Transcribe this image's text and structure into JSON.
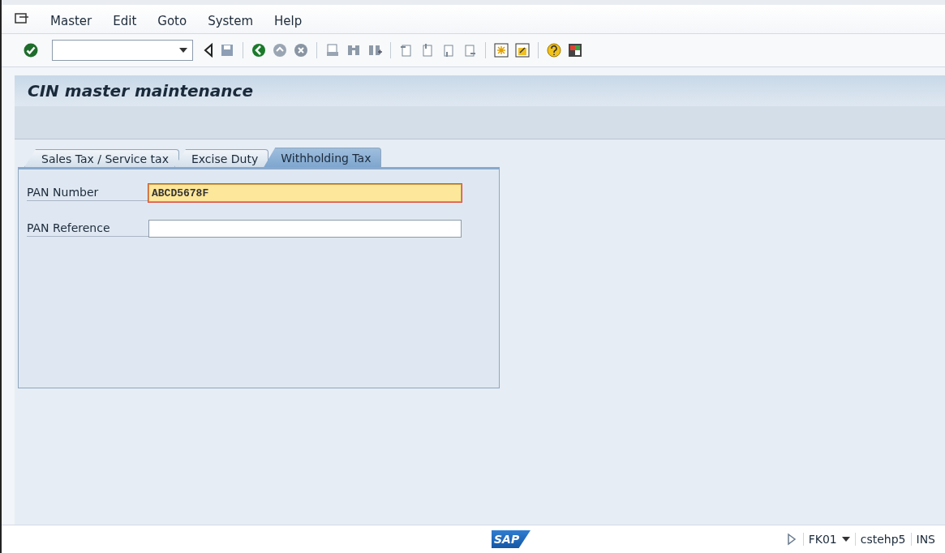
{
  "menu": [
    "Master",
    "Edit",
    "Goto",
    "System",
    "Help"
  ],
  "title": "CIN master maintenance",
  "tabs": [
    {
      "label": "Sales Tax / Service tax",
      "selected": false
    },
    {
      "label": "Excise Duty",
      "selected": false
    },
    {
      "label": "Withholding Tax",
      "selected": true
    }
  ],
  "fields": [
    {
      "label": "PAN Number",
      "value": "ABCD5678F",
      "focused": true
    },
    {
      "label": "PAN Reference",
      "focused": false
    }
  ],
  "status_bar": {
    "logo": "SAP",
    "transaction": "FK01",
    "server": "cstehp5",
    "mode": "INS"
  }
}
